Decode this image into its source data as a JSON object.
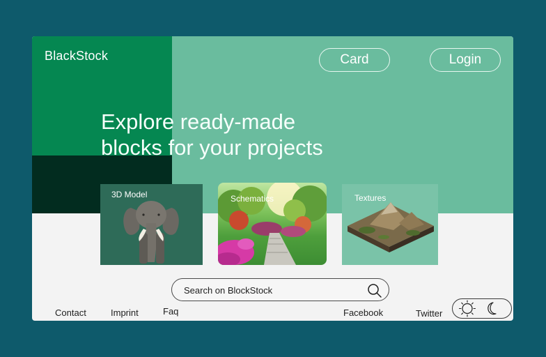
{
  "header": {
    "brand": "BlackStock",
    "card_label": "Card",
    "login_label": "Login"
  },
  "hero": {
    "line1": "Explore ready-made",
    "line2": "blocks for your projects"
  },
  "tiles": [
    {
      "label": "3D Model",
      "image": "elephant-image"
    },
    {
      "label": "Schematics",
      "image": "garden-path-image"
    },
    {
      "label": "Textures",
      "image": "terrain-image"
    }
  ],
  "search": {
    "placeholder": "Search on BlockStock",
    "icon": "search-icon"
  },
  "footer": {
    "contact": "Contact",
    "imprint": "Imprint",
    "faq": "Faq",
    "facebook": "Facebook",
    "twitter": "Twitter"
  },
  "theme_toggle": {
    "icons": [
      "sun-icon",
      "moon-icon"
    ]
  },
  "colors": {
    "page_bg": "#0e5a6b",
    "hero_bg": "#6abc9e",
    "brand_green": "#058751",
    "dark_green": "#022c1f",
    "tile_3d": "#2e6b58",
    "tile_textures": "#7ac3a8"
  }
}
